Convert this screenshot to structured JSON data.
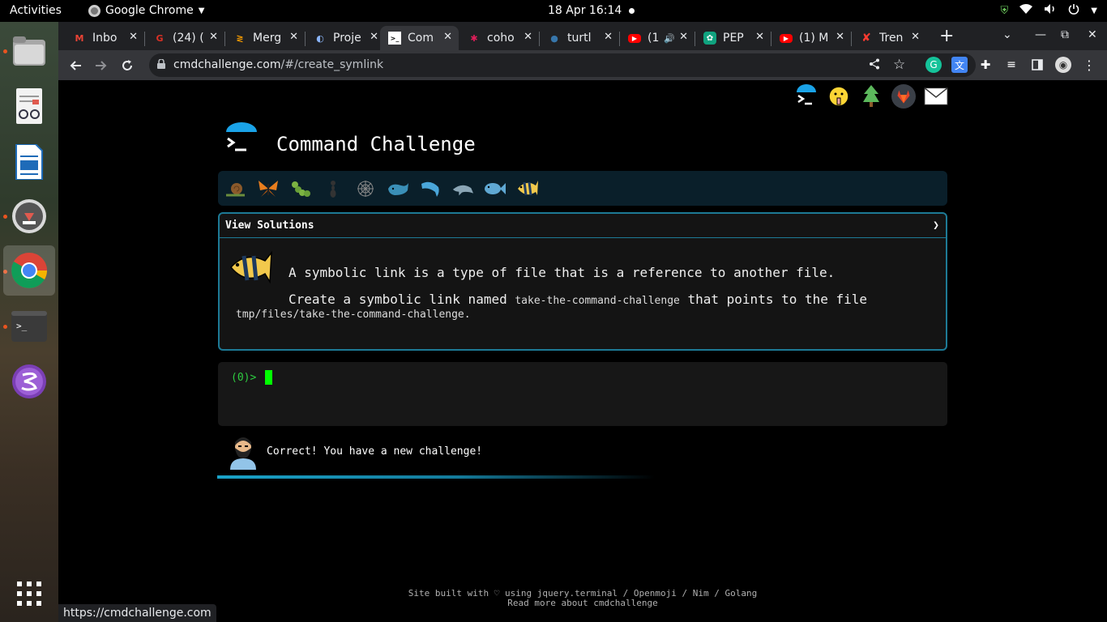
{
  "system": {
    "activities": "Activities",
    "app_name": "Google Chrome",
    "clock": "18 Apr  16:14"
  },
  "browser": {
    "tabs": [
      {
        "label": "Inbo",
        "icon": "gmail-icon",
        "color": "#ea4335"
      },
      {
        "label": "(24) (",
        "icon": "grammarly-icon",
        "color": "#d93025"
      },
      {
        "label": "Merg",
        "icon": "merge-icon",
        "color": "#f29900"
      },
      {
        "label": "Proje",
        "icon": "github-icon",
        "color": "#8ab4f8"
      },
      {
        "label": "Com",
        "icon": "terminal-icon",
        "color": "#ffffff"
      },
      {
        "label": "coho",
        "icon": "slack-icon",
        "color": "#e01e5a"
      },
      {
        "label": "turtl",
        "icon": "python-icon",
        "color": "#3776ab"
      },
      {
        "label": "(1",
        "icon": "youtube-icon",
        "color": "#ff0000"
      },
      {
        "label": "PEP",
        "icon": "chatgpt-icon",
        "color": "#10a37f"
      },
      {
        "label": "(1) M",
        "icon": "youtube-icon",
        "color": "#ff0000"
      },
      {
        "label": "Tren",
        "icon": "x-icon",
        "color": "#ff3b30"
      }
    ],
    "url_host": "cmdchallenge.com",
    "url_path": "/#/create_symlink",
    "status_url": "https://cmdchallenge.com"
  },
  "page": {
    "title": "Command Challenge",
    "view_solutions": "View Solutions",
    "chevron": "❯",
    "challenge_line1": "A symbolic link is a type of file that is a reference to another file.",
    "challenge_line2_prefix": "Create a symbolic link named ",
    "challenge_code1": "take-the-command-challenge",
    "challenge_line2_suffix": " that points to the file",
    "challenge_code2": "tmp/files/take-the-command-challenge.",
    "prompt": "(0)>",
    "feedback": "Correct! You have a new challenge!",
    "footer_line1": "Site built with ♡ using jquery.terminal / Openmoji / Nim / Golang",
    "footer_line2": "Read more about cmdchallenge",
    "progress": 0.6
  },
  "colors": {
    "accent": "#1d7a96",
    "prompt": "#2ecc40",
    "cursor": "#00ff00"
  }
}
